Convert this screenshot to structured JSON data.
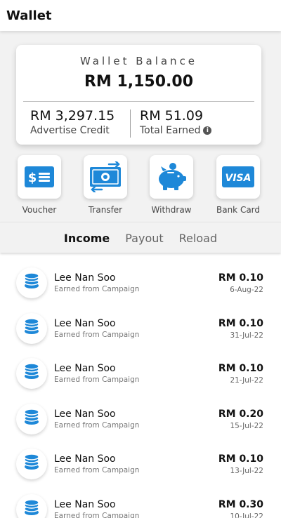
{
  "header": {
    "title": "Wallet"
  },
  "balance": {
    "label": "Wallet Balance",
    "amount": "RM 1,150.00",
    "advertise_credit": {
      "amount": "RM 3,297.15",
      "label": "Advertise Credit"
    },
    "total_earned": {
      "amount": "RM 51.09",
      "label": "Total Earned",
      "info_icon": "i"
    }
  },
  "actions": [
    {
      "label": "Voucher",
      "icon": "voucher-icon"
    },
    {
      "label": "Transfer",
      "icon": "transfer-icon"
    },
    {
      "label": "Withdraw",
      "icon": "piggy-bank-icon"
    },
    {
      "label": "Bank Card",
      "icon": "visa-card-icon",
      "icon_text": "VISA"
    }
  ],
  "tabs": [
    {
      "label": "Income",
      "active": true
    },
    {
      "label": "Payout",
      "active": false
    },
    {
      "label": "Reload",
      "active": false
    }
  ],
  "transactions": [
    {
      "name": "Lee Nan Soo",
      "desc": "Earned from Campaign",
      "amount": "RM 0.10",
      "date": "6-Aug-22"
    },
    {
      "name": "Lee Nan Soo",
      "desc": "Earned from Campaign",
      "amount": "RM 0.10",
      "date": "31-Jul-22"
    },
    {
      "name": "Lee Nan Soo",
      "desc": "Earned from Campaign",
      "amount": "RM 0.10",
      "date": "21-Jul-22"
    },
    {
      "name": "Lee Nan Soo",
      "desc": "Earned from Campaign",
      "amount": "RM 0.20",
      "date": "15-Jul-22"
    },
    {
      "name": "Lee Nan Soo",
      "desc": "Earned from Campaign",
      "amount": "RM 0.10",
      "date": "13-Jul-22"
    },
    {
      "name": "Lee Nan Soo",
      "desc": "Earned from Campaign",
      "amount": "RM 0.30",
      "date": "10-Jul-22"
    }
  ],
  "colors": {
    "accent": "#1e88d8",
    "background": "#f2f2f2"
  }
}
